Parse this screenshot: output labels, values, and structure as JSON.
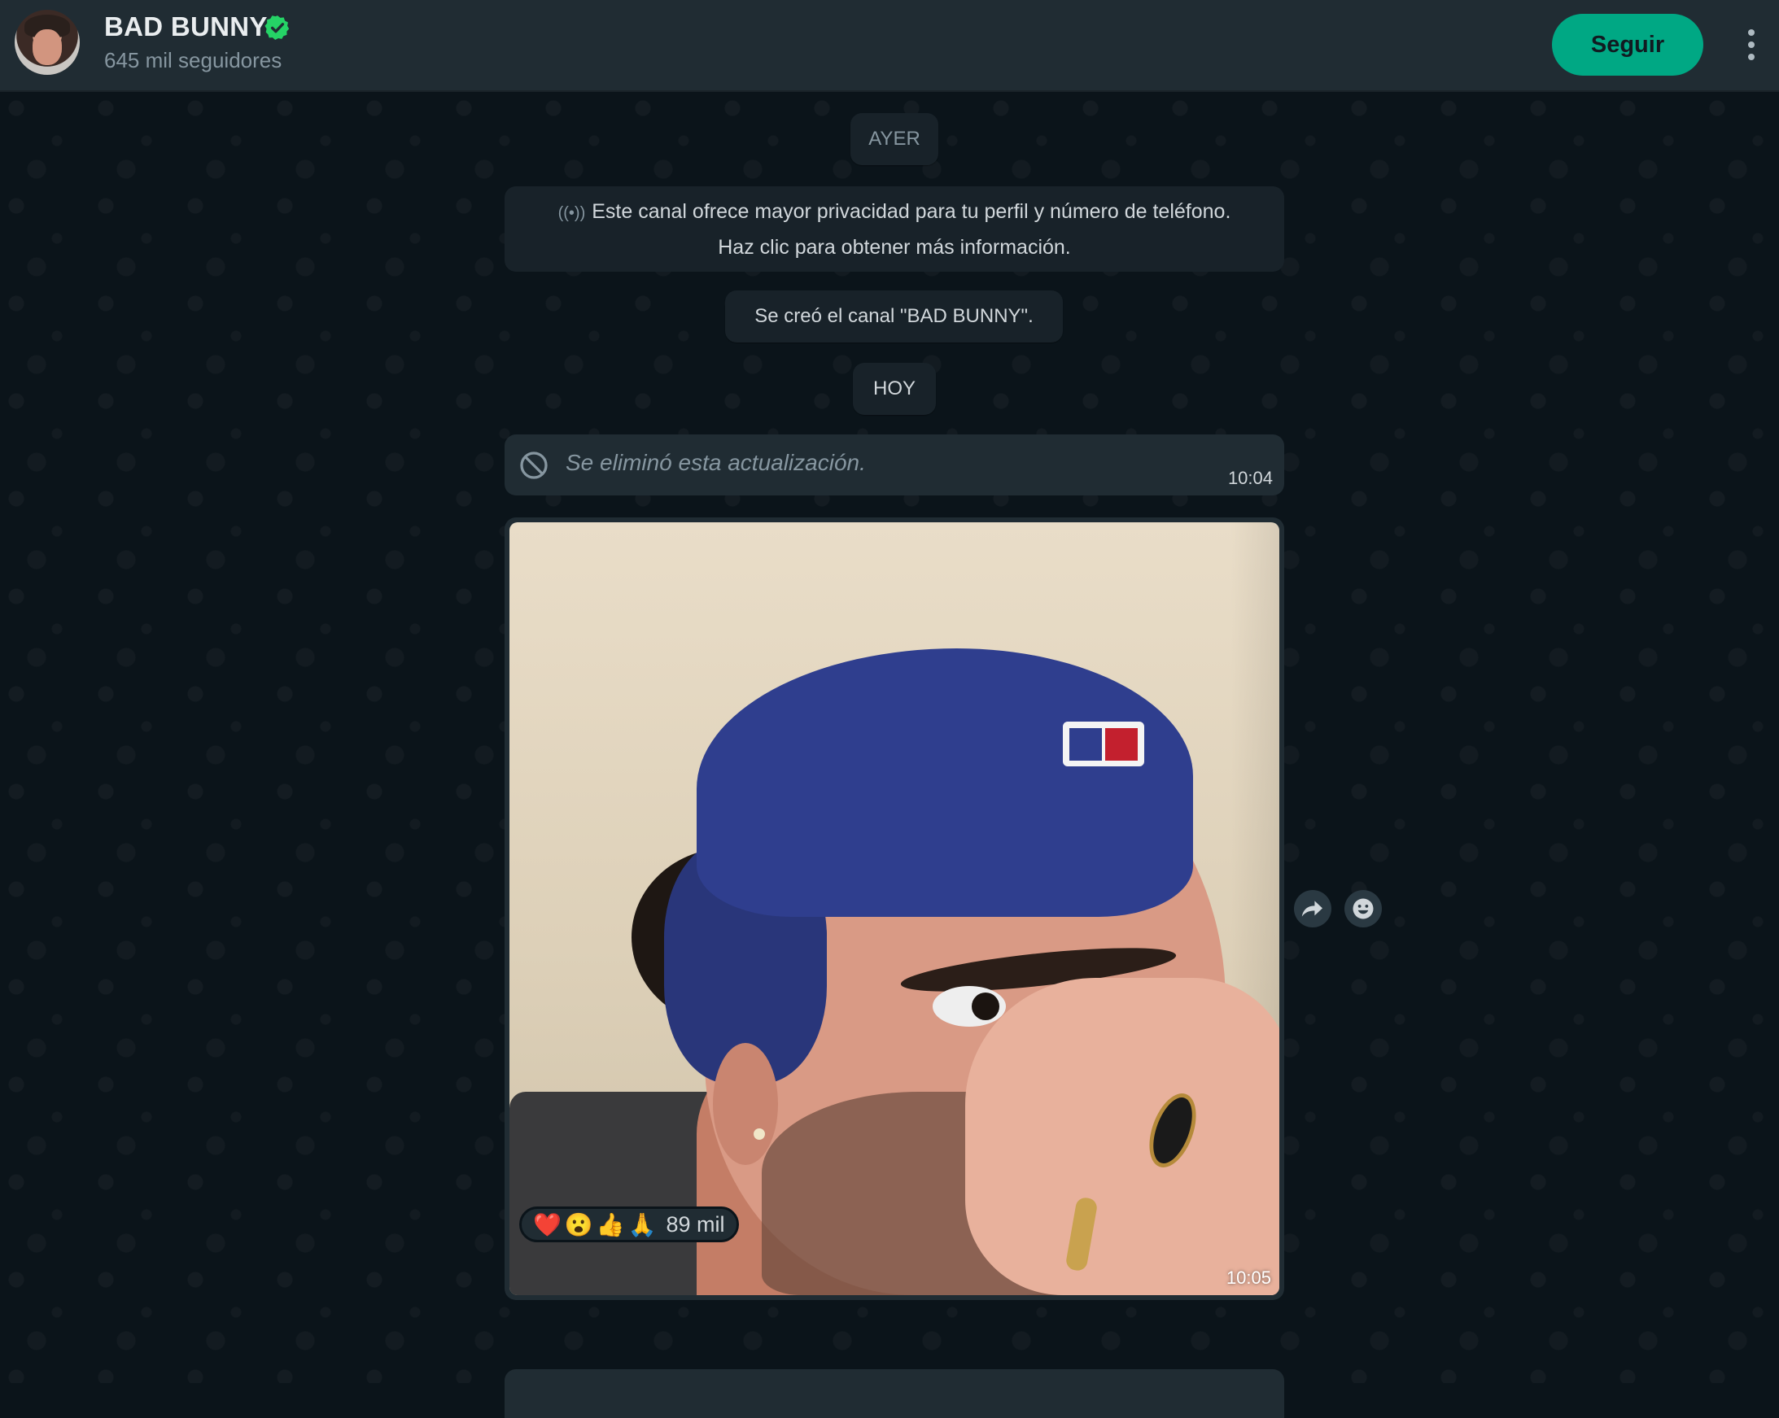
{
  "header": {
    "channel_name": "BAD BUNNY",
    "followers": "645 mil seguidores",
    "follow_label": "Seguir",
    "verified_icon": "verified-badge-icon",
    "menu_icon": "kebab-menu-icon",
    "accent_color": "#00a884"
  },
  "chat": {
    "date_yesterday": "AYER",
    "privacy_notice_line1": "Este canal ofrece mayor privacidad para tu perfil y número de teléfono.",
    "privacy_notice_line2": "Haz clic para obtener más información.",
    "channel_created": "Se creó el canal \"BAD BUNNY\".",
    "date_today": "HOY",
    "deleted_message": "Se eliminó esta actualización.",
    "deleted_time": "10:04",
    "photo_time": "10:05",
    "reactions": {
      "emojis": [
        "❤️",
        "😮",
        "👍",
        "🙏"
      ],
      "count": "89 mil"
    }
  }
}
